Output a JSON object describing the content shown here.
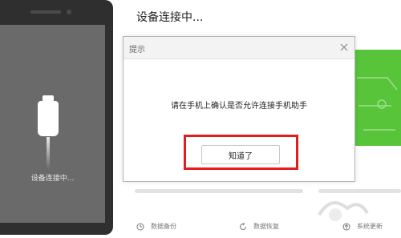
{
  "phone": {
    "status_text": "设备连接中..."
  },
  "main": {
    "title": "设备连接中..."
  },
  "dialog": {
    "title": "提示",
    "message": "请在手机上确认是否允许连接手机助手",
    "ok_label": "知道了"
  },
  "bottom_bar": {
    "items": [
      {
        "label": "数据备份",
        "icon": "clock-icon"
      },
      {
        "label": "数据恢复",
        "icon": "restore-icon"
      },
      {
        "label": "系统更新",
        "icon": "update-icon"
      }
    ]
  },
  "colors": {
    "highlight": "#e61c1c",
    "green_panel": "#57c43a",
    "phone_body": "#2f2f2f"
  }
}
